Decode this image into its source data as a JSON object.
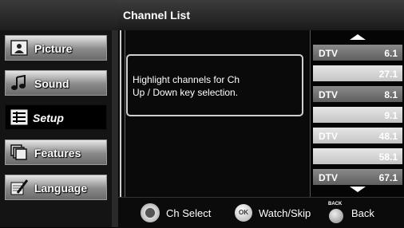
{
  "header": {
    "title": "Channel List"
  },
  "menu": [
    {
      "label": "Picture",
      "icon": "picture-icon",
      "active": false
    },
    {
      "label": "Sound",
      "icon": "sound-icon",
      "active": false
    },
    {
      "label": "Setup",
      "icon": "setup-icon",
      "active": true
    },
    {
      "label": "Features",
      "icon": "features-icon",
      "active": false
    },
    {
      "label": "Language",
      "icon": "language-icon",
      "active": false
    }
  ],
  "message": {
    "line1": "Highlight channels for Ch",
    "line2": "Up / Down key selection."
  },
  "channels": [
    {
      "tag": "DTV",
      "number": "6.1",
      "style": "dark"
    },
    {
      "tag": "",
      "number": "27.1",
      "style": "light"
    },
    {
      "tag": "DTV",
      "number": "8.1",
      "style": "dark"
    },
    {
      "tag": "",
      "number": "9.1",
      "style": "light"
    },
    {
      "tag": "DTV",
      "number": "48.1",
      "style": "light"
    },
    {
      "tag": "",
      "number": "58.1",
      "style": "light"
    },
    {
      "tag": "DTV",
      "number": "67.1",
      "style": "dark"
    }
  ],
  "footer": {
    "ch_select": "Ch Select",
    "ok_label": "OK",
    "watch_skip": "Watch/Skip",
    "back_key": "BACK",
    "back": "Back"
  }
}
